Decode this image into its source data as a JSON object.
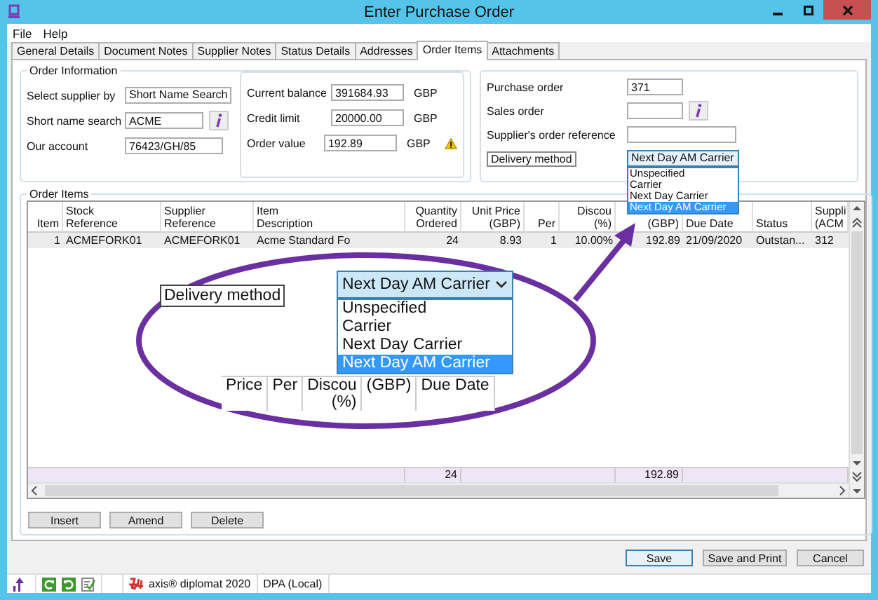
{
  "window": {
    "title": "Enter Purchase Order"
  },
  "menu": [
    {
      "label": "File"
    },
    {
      "label": "Help"
    }
  ],
  "tabs": [
    {
      "label": "General Details",
      "selected": false
    },
    {
      "label": "Document Notes",
      "selected": false
    },
    {
      "label": "Supplier Notes",
      "selected": false
    },
    {
      "label": "Status Details",
      "selected": false
    },
    {
      "label": "Addresses",
      "selected": false
    },
    {
      "label": "Order Items",
      "selected": true
    },
    {
      "label": "Attachments",
      "selected": false
    }
  ],
  "order_information": {
    "title": "Order Information",
    "supplier_fields": [
      {
        "kind": "select",
        "label": "Select supplier by",
        "value": "Short Name Search"
      },
      {
        "kind": "lookup",
        "label": "Short name search",
        "value": "ACME"
      },
      {
        "kind": "text",
        "label": "Our account",
        "value": "76423/GH/85"
      }
    ],
    "account_fields": [
      {
        "label": "Current balance",
        "value": "391684.93",
        "unit": "GBP",
        "warning": false
      },
      {
        "label": "Credit limit",
        "value": "20000.00",
        "unit": "GBP",
        "warning": false
      },
      {
        "label": "Order value",
        "value": "192.89",
        "unit": "GBP",
        "warning": true
      }
    ]
  },
  "references": {
    "fields": [
      {
        "kind": "text",
        "label": "Purchase order",
        "value": "371"
      },
      {
        "kind": "lookup",
        "label": "Sales order"
      },
      {
        "kind": "wide",
        "label": "Supplier's order reference"
      },
      {
        "kind": "dropdown",
        "label": "Delivery method",
        "value": "Next Day AM Carrier",
        "expanded": true,
        "options": [
          {
            "label": "Unspecified",
            "selected": false
          },
          {
            "label": "Carrier",
            "selected": false
          },
          {
            "label": "Next Day Carrier",
            "selected": false
          },
          {
            "label": "Next Day AM Carrier",
            "selected": true
          }
        ]
      }
    ]
  },
  "order_items": {
    "title": "Order Items",
    "columns": [
      {
        "lines": [
          "Item"
        ]
      },
      {
        "lines": [
          "Stock",
          "Reference"
        ]
      },
      {
        "lines": [
          "Supplier",
          "Reference"
        ]
      },
      {
        "lines": [
          "Item",
          "Description"
        ]
      },
      {
        "lines": [
          "Quantity",
          "Ordered"
        ]
      },
      {
        "lines": [
          "Unit Price",
          "(GBP)"
        ]
      },
      {
        "lines": [
          "Per"
        ]
      },
      {
        "lines": [
          "Discou",
          "(%)"
        ]
      },
      {
        "lines": [
          "(GBP)"
        ]
      },
      {
        "lines": [
          "Due Date"
        ]
      },
      {
        "lines": [
          "Status"
        ]
      },
      {
        "lines": [
          "Suppli",
          "(ACM"
        ]
      }
    ],
    "rows": [
      {
        "cells": [
          "1",
          "ACMEFORK01",
          "ACMEFORK01",
          "Acme Standard Fo",
          "24",
          "8.93",
          "1",
          "10.00%",
          "192.89",
          "21/09/2020",
          "Outstan...",
          "312"
        ]
      }
    ],
    "totals": {
      "quantity": "24",
      "total": "192.89"
    },
    "buttons": [
      {
        "label": "Insert"
      },
      {
        "label": "Amend"
      },
      {
        "label": "Delete"
      }
    ]
  },
  "callout": {
    "label": "Delivery method",
    "value": "Next Day AM Carrier",
    "options": [
      {
        "label": "Unspecified",
        "selected": false
      },
      {
        "label": "Carrier",
        "selected": false
      },
      {
        "label": "Next Day Carrier",
        "selected": false
      },
      {
        "label": "Next Day AM Carrier",
        "selected": true
      }
    ],
    "header": [
      {
        "lines": [
          "Price"
        ]
      },
      {
        "lines": [
          "Per"
        ]
      },
      {
        "lines": [
          "Discou",
          "(%)"
        ]
      },
      {
        "lines": [
          "(GBP)"
        ]
      },
      {
        "lines": [
          "Due Date"
        ]
      }
    ]
  },
  "footer_buttons": [
    {
      "label": "Save",
      "default": true
    },
    {
      "label": "Save and Print",
      "default": false
    },
    {
      "label": "Cancel",
      "default": false
    }
  ],
  "status_bar": {
    "product": "axis® diplomat 2020",
    "database": "DPA (Local)"
  }
}
